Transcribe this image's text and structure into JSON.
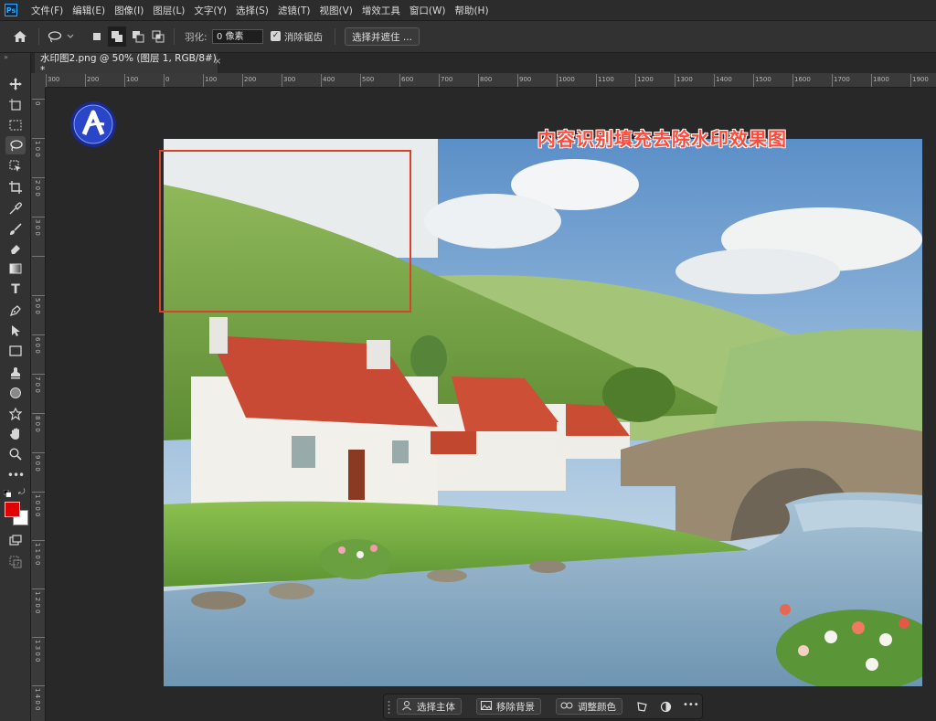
{
  "menubar": {
    "app_icon": "Ps",
    "items": [
      "文件(F)",
      "编辑(E)",
      "图像(I)",
      "图层(L)",
      "文字(Y)",
      "选择(S)",
      "滤镜(T)",
      "视图(V)",
      "增效工具",
      "窗口(W)",
      "帮助(H)"
    ]
  },
  "options": {
    "feather_label": "羽化:",
    "feather_value": "0 像素",
    "antialias_label": "消除锯齿",
    "antialias_checked": true,
    "select_mask_button": "选择并遮住 ..."
  },
  "document": {
    "tab_title": "水印图2.png @ 50% (图层 1, RGB/8#) *",
    "close_glyph": "×"
  },
  "rulers": {
    "horizontal": [
      "300",
      "200",
      "100",
      "0",
      "100",
      "200",
      "300",
      "400",
      "500",
      "600",
      "700",
      "800",
      "900",
      "1000",
      "1100",
      "1200",
      "1300",
      "1400",
      "1500",
      "1600",
      "1700",
      "1800",
      "1900"
    ],
    "vertical": [
      "0",
      "1 0 0",
      "2 0 0",
      "3 0 0",
      "5 0 0",
      "6 0 0",
      "7 0 0",
      "8 0 0",
      "9 0 0",
      "1 0 0 0",
      "1 1 0 0",
      "1 2 0 0",
      "1 3 0 0",
      "1 4 0 0"
    ]
  },
  "canvas": {
    "overlay_title": "内容识别填充去除水印效果图"
  },
  "contextual_taskbar": {
    "select_subject": "选择主体",
    "remove_background": "移除背景",
    "adjust_colors": "调整颜色",
    "more_glyph": "•••"
  },
  "colors": {
    "foreground": "#e00000",
    "background": "#ffffff",
    "selection_rect": "#d9412b",
    "overlay_text": "#ff4a3a"
  },
  "toolbar_icons": [
    "move-icon",
    "artboard-icon",
    "marquee-icon",
    "lasso-icon",
    "object-select-icon",
    "crop-icon",
    "eyedropper-icon",
    "brush-icon",
    "eraser-icon",
    "gradient-icon",
    "type-icon",
    "pen-icon",
    "path-select-icon",
    "rectangle-icon",
    "clone-stamp-icon",
    "ellipse-icon",
    "puppet-icon",
    "hand-icon",
    "zoom-icon",
    "more-tools-icon"
  ]
}
